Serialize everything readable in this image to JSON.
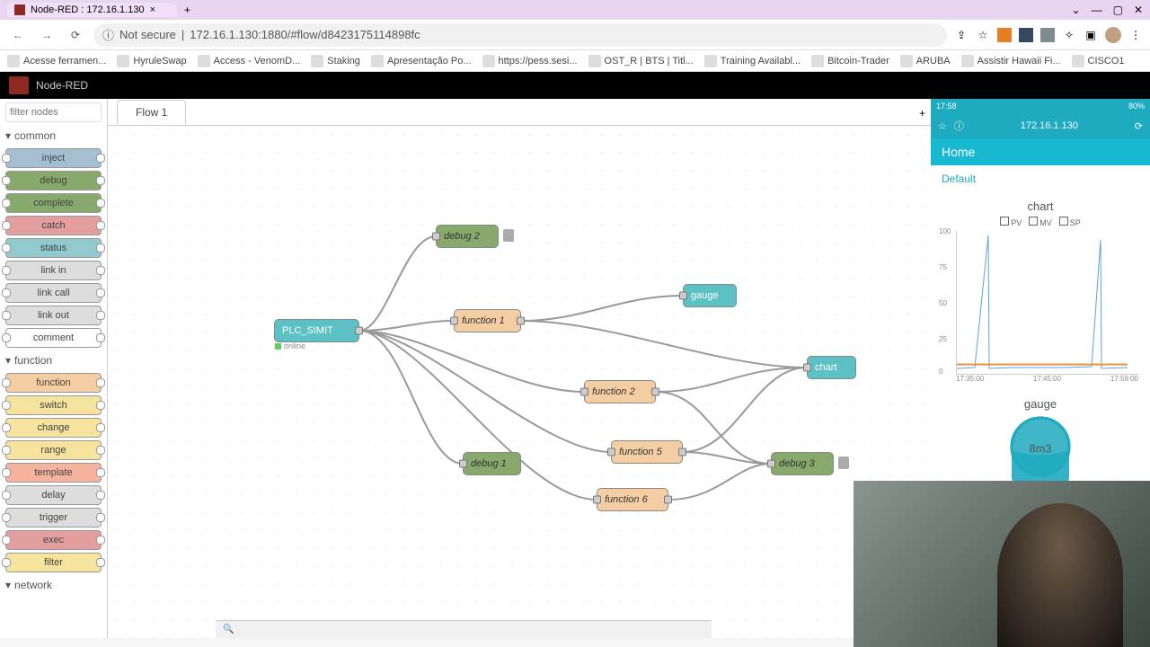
{
  "browser": {
    "tab_title": "Node-RED : 172.16.1.130",
    "url_insecure": "Not secure",
    "url": "172.16.1.130:1880/#flow/d8423175114898fc",
    "bookmarks": [
      "Acesse ferramen...",
      "HyruleSwap",
      "Access - VenomD...",
      "Staking",
      "Apresentação Po...",
      "https://pess.sesi...",
      "OST_R | BTS | Titl...",
      "Training Availabl...",
      "Bitcoin-Trader",
      "ARUBA",
      "Assistir Hawaii Fi...",
      "CISCO1"
    ]
  },
  "app": {
    "title": "Node-RED",
    "filter_placeholder": "filter nodes",
    "flow_tab": "Flow 1",
    "categories": {
      "common": "common",
      "function": "function",
      "network": "network"
    },
    "palette": {
      "inject": "inject",
      "debug": "debug",
      "complete": "complete",
      "catch": "catch",
      "status": "status",
      "link_in": "link in",
      "link_call": "link call",
      "link_out": "link out",
      "comment": "comment",
      "function": "function",
      "switch": "switch",
      "change": "change",
      "range": "range",
      "template": "template",
      "delay": "delay",
      "trigger": "trigger",
      "exec": "exec",
      "filter": "filter"
    },
    "nodes": {
      "plc": "PLC_SIMIT",
      "plc_status": "online",
      "debug2": "debug 2",
      "gauge": "gauge",
      "fn1": "function 1",
      "chart": "chart",
      "fn2": "function 2",
      "fn5": "function 5",
      "debug1": "debug 1",
      "debug3": "debug 3",
      "fn6": "function 6"
    }
  },
  "phone": {
    "time": "17:58",
    "battery": "80%",
    "url": "172.16.1.130",
    "home": "Home",
    "default": "Default",
    "chart_title": "chart",
    "gauge_title": "gauge",
    "gauge_value": "8m3",
    "legend": {
      "pv": "PV",
      "mv": "MV",
      "sp": "SP"
    },
    "y_ticks": [
      "100",
      "75",
      "50",
      "25",
      "0"
    ],
    "x_ticks": [
      "17:35:00",
      "17:45:00",
      "17:59:00"
    ]
  },
  "chart_data": {
    "type": "line",
    "title": "chart",
    "xlabel": "",
    "ylabel": "",
    "ylim": [
      0,
      100
    ],
    "x_range": [
      "17:35:00",
      "17:59:00"
    ],
    "series": [
      {
        "name": "PV",
        "color": "#5aa3d8",
        "values_sample": [
          3,
          4,
          98,
          3,
          3,
          4,
          4,
          3,
          4,
          95,
          3
        ]
      },
      {
        "name": "MV",
        "color": "#e8a33c",
        "values_sample": [
          5,
          5,
          5,
          5,
          5,
          6,
          5,
          5,
          5,
          5,
          5
        ]
      },
      {
        "name": "SP",
        "color": "#e87d3c",
        "values_sample": [
          5,
          5,
          5,
          5,
          5,
          5,
          5,
          5,
          5,
          5,
          5
        ]
      }
    ]
  }
}
